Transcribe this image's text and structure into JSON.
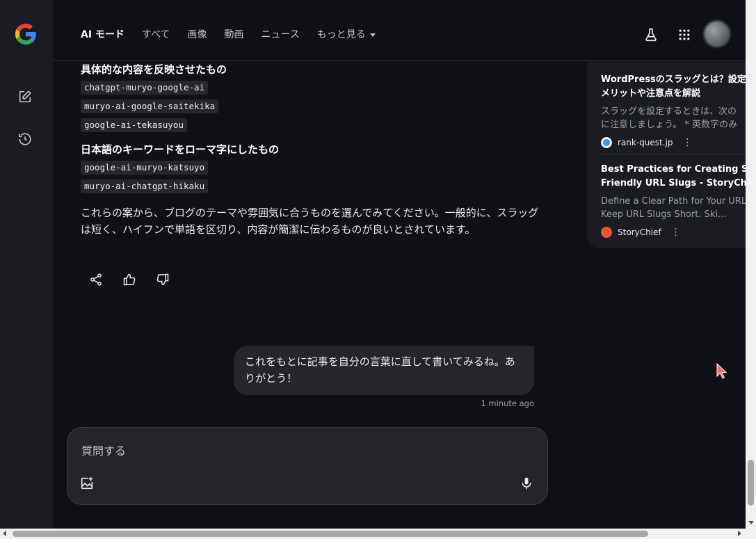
{
  "header": {
    "tabs": [
      {
        "label": "AI モード",
        "active": true
      },
      {
        "label": "すべて"
      },
      {
        "label": "画像"
      },
      {
        "label": "動画"
      },
      {
        "label": "ニュース"
      },
      {
        "label": "もっと見る"
      }
    ],
    "icons": [
      "labs-flask-icon",
      "apps-grid-icon"
    ]
  },
  "rail": {
    "icons": [
      "google-logo",
      "new-chat-edit-icon",
      "history-icon"
    ]
  },
  "answer": {
    "section1": {
      "heading": "具体的な内容を反映させたもの",
      "slugs": [
        "chatgpt-muryo-google-ai",
        "muryo-ai-google-saitekika",
        "google-ai-tekasuyou"
      ]
    },
    "section2": {
      "heading": "日本語のキーワードをローマ字にしたもの",
      "slugs": [
        "google-ai-muryo-katsuyo",
        "muryo-ai-chatgpt-hikaku"
      ]
    },
    "closing": "これらの案から、ブログのテーマや雰囲気に合うものを選んでみてください。一般的に、スラッグは短く、ハイフンで単語を区切り、内容が簡潔に伝わるものが良いとされています。",
    "actions": [
      "share-icon",
      "thumbs-up-icon",
      "thumbs-down-icon"
    ]
  },
  "user_message": {
    "text": "これをもとに記事を自分の言葉に直して書いてみるね。ありがとう！",
    "timestamp": "1 minute ago"
  },
  "composer": {
    "placeholder": "質問する"
  },
  "sources": [
    {
      "title": "WordPressのスラッグとは？設定のメリットや注意点を解説",
      "title_line1": "WordPressのスラッグとは？設定",
      "title_line2": "メリットや注意点を解説",
      "snippet_line1": "スラッグを設定するときは、次の",
      "snippet_line2": "に注意しましょう。 * 英数字のみ",
      "site": "rank-quest.jp",
      "favicon_color": "#2a9df4"
    },
    {
      "title_line1": "Best Practices for Creating SEO",
      "title_line2": "Friendly URL Slugs - StoryChief",
      "snippet_line1": "Define a Clear Path for Your URLs",
      "snippet_line2": "Keep URL Slugs Short. Ski...",
      "site": "StoryChief",
      "favicon_color": "#e8552f"
    }
  ],
  "colors": {
    "background": "#101116",
    "panel": "#1b1c22",
    "bubble": "#25262c",
    "text": "#e8eaed",
    "muted": "#9aa0a6"
  }
}
